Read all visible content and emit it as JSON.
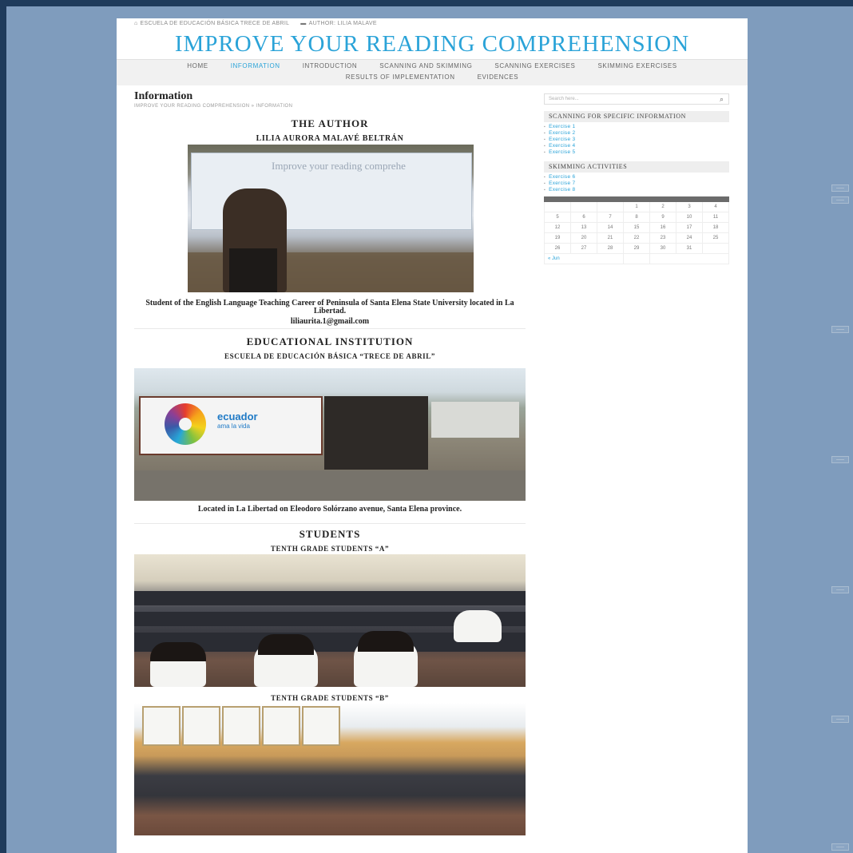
{
  "topbar": {
    "school": "ESCUELA DE EDUCACIÓN BÁSICA TRECE DE ABRIL",
    "author": "AUTHOR: LILIA MALAVE"
  },
  "site_title": "IMPROVE YOUR READING COMPREHENSION",
  "nav": {
    "row1": [
      "HOME",
      "INFORMATION",
      "INTRODUCTION",
      "SCANNING AND SKIMMING",
      "SCANNING EXERCISES",
      "SKIMMING EXERCISES"
    ],
    "row2": [
      "RESULTS OF IMPLEMENTATION",
      "EVIDENCES"
    ],
    "active": "INFORMATION"
  },
  "page": {
    "heading": "Information",
    "breadcrumb": "IMPROVE YOUR READING COMPREHENSION » INFORMATION"
  },
  "author": {
    "section_title": "THE AUTHOR",
    "name": "LILIA AURORA MALAVÉ BELTRÁN",
    "photo_screen_text": "Improve your reading comprehe",
    "description": "Student of the English Language Teaching Career of Peninsula of Santa Elena State University located in La Libertad.",
    "email": "liliaurita.1@gmail.com"
  },
  "institution": {
    "section_title": "EDUCATIONAL INSTITUTION",
    "name": "ESCUELA DE EDUCACIÓN BÁSICA “TRECE DE ABRIL”",
    "logo_text": "ecuador",
    "logo_subtext": "ama la vida",
    "location": "Located in La Libertad on Eleodoro Solórzano avenue, Santa Elena province."
  },
  "students": {
    "section_title": "STUDENTS",
    "group_a": "TENTH GRADE STUDENTS “A”",
    "group_b": "TENTH GRADE STUDENTS “B”"
  },
  "sidebar": {
    "search_placeholder": "Search here...",
    "widget1_title": "SCANNING FOR SPECIFIC INFORMATION",
    "widget1_items": [
      "Exercise 1",
      "Exercise 2",
      "Exercise 3",
      "Exercise 4",
      "Exercise 5"
    ],
    "widget2_title": "SKIMMING ACTIVITIES",
    "widget2_items": [
      "Exercise 6",
      "Exercise 7",
      "Exercise 8"
    ],
    "calendar": {
      "weeks": [
        [
          "",
          "",
          "",
          "1",
          "2",
          "3",
          "4"
        ],
        [
          "5",
          "6",
          "7",
          "8",
          "9",
          "10",
          "11"
        ],
        [
          "12",
          "13",
          "14",
          "15",
          "16",
          "17",
          "18"
        ],
        [
          "19",
          "20",
          "21",
          "22",
          "23",
          "24",
          "25"
        ],
        [
          "26",
          "27",
          "28",
          "29",
          "30",
          "31",
          ""
        ]
      ],
      "prev_link": "« Jun"
    }
  },
  "colors": {
    "accent": "#2aa3d8",
    "background": "#7f9cbd",
    "frame": "#1f3b5b"
  }
}
